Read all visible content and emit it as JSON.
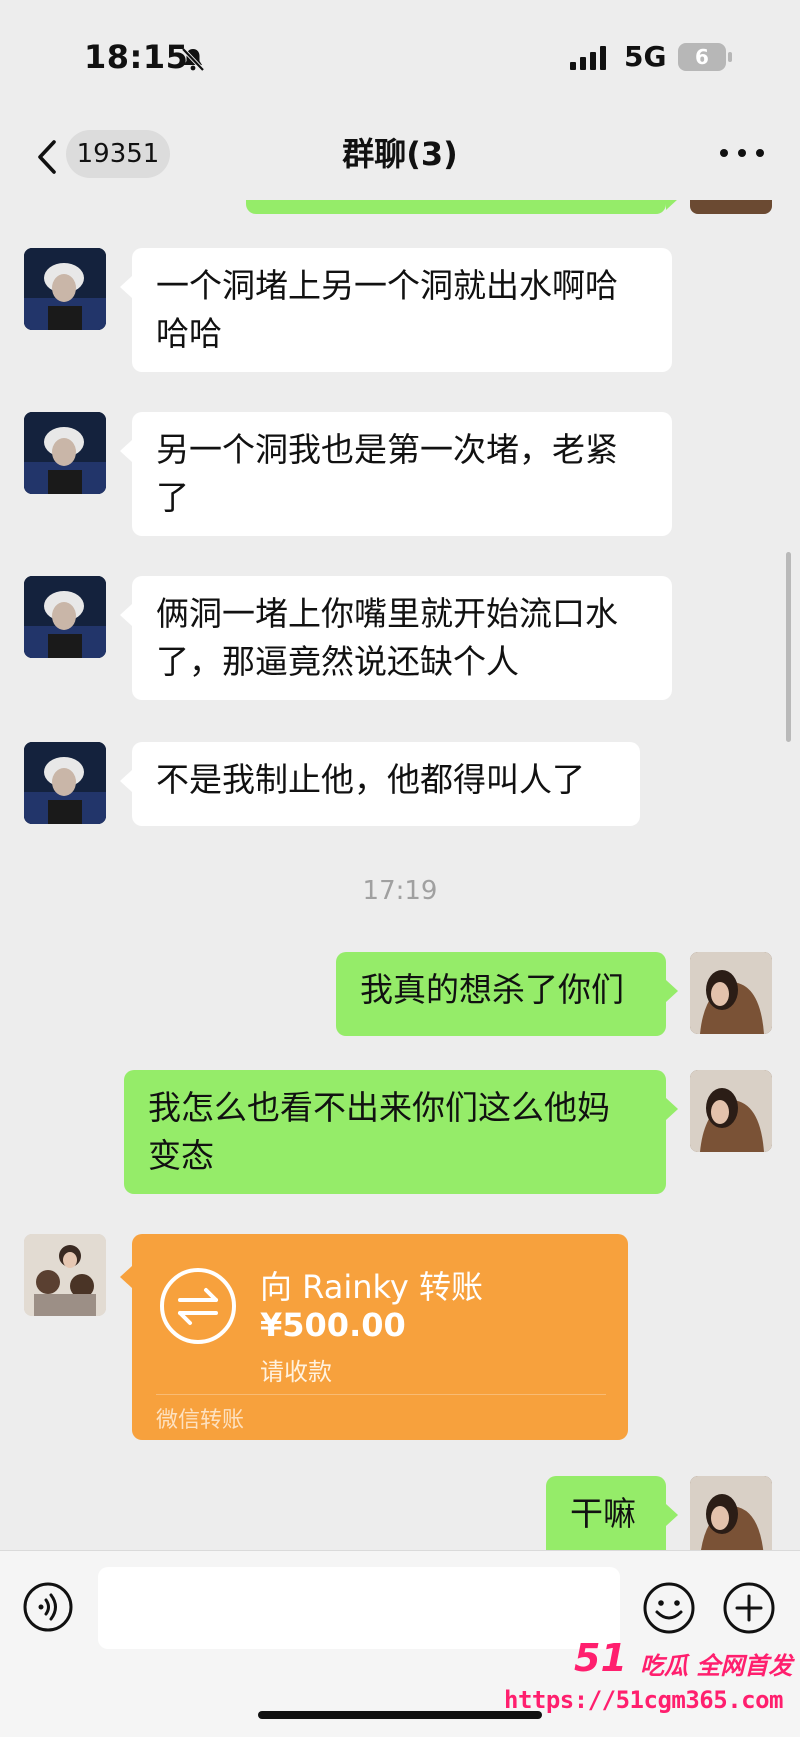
{
  "status_bar": {
    "time": "18:15",
    "network": "5G",
    "battery": "6"
  },
  "nav": {
    "unread_count": "19351",
    "title": "群聊(3)"
  },
  "messages": [
    {
      "from": "other",
      "avatar": "white-hair-portrait",
      "text": "一个洞堵上另一个洞就出水啊哈哈哈"
    },
    {
      "from": "other",
      "avatar": "white-hair-portrait",
      "text": "另一个洞我也是第一次堵，老紧了"
    },
    {
      "from": "other",
      "avatar": "white-hair-portrait",
      "text": "俩洞一堵上你嘴里就开始流口水了，那逼竟然说还缺个人"
    },
    {
      "from": "other",
      "avatar": "white-hair-portrait",
      "text": "不是我制止他，他都得叫人了"
    },
    {
      "from": "self",
      "avatar": "girl-fur-coat",
      "text": "我真的想杀了你们"
    },
    {
      "from": "self",
      "avatar": "girl-fur-coat",
      "text": "我怎么也看不出来你们这么他妈变态"
    },
    {
      "from": "self",
      "avatar": "girl-fur-coat",
      "text": "干嘛"
    }
  ],
  "timestamp": "17:19",
  "transfer": {
    "title": "向 Rainky 转账",
    "amount": "¥500.00",
    "status": "请收款",
    "footer": "微信转账",
    "color": "#f7a13d"
  },
  "input_bar": {
    "placeholder": ""
  },
  "watermark": {
    "logo": "51",
    "slogan": "吃瓜 全网首发",
    "url": "https://51cgm365.com"
  },
  "colors": {
    "outgoing_bubble": "#95ec69",
    "incoming_bubble": "#ffffff",
    "background": "#ededed"
  }
}
